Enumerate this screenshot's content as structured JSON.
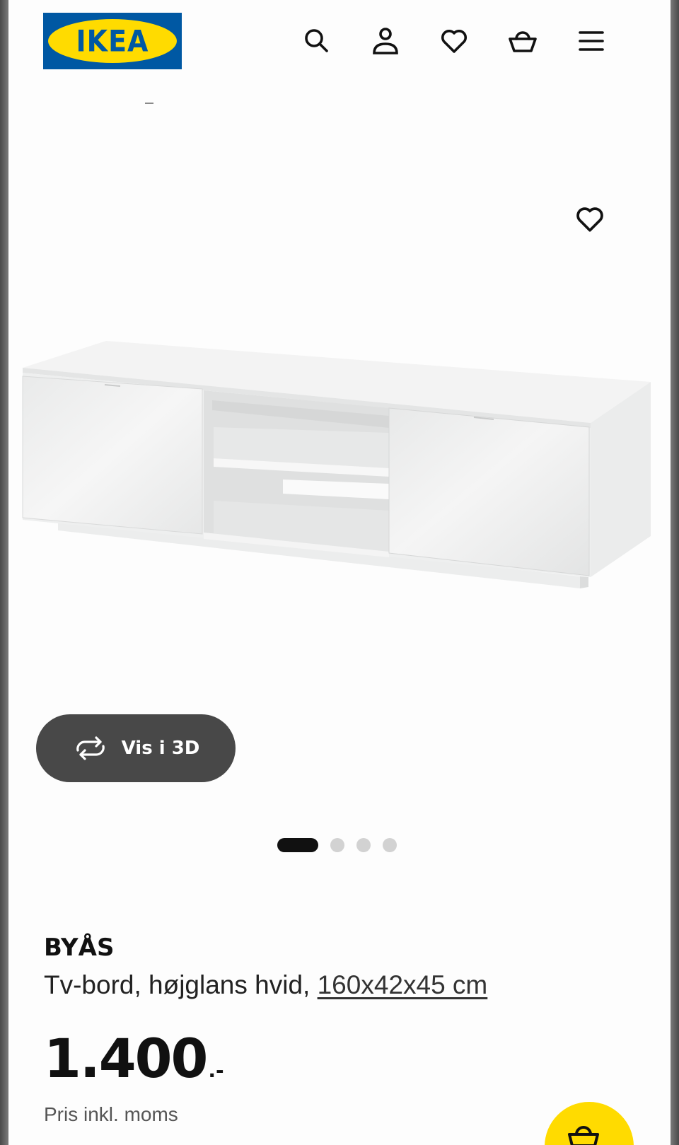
{
  "header": {
    "logo_text": "IKEA",
    "icons": [
      "search-icon",
      "user-icon",
      "heart-icon",
      "basket-icon",
      "menu-icon"
    ]
  },
  "gallery": {
    "view_3d_label": "Vis i 3D",
    "slides_total": 4,
    "active_slide": 1
  },
  "product": {
    "name": "BYÅS",
    "description": "Tv-bord, højglans hvid,",
    "dimensions": "160x42x45 cm",
    "price_integer": "1.400",
    "price_suffix": ".-",
    "price_note": "Pris inkl. moms"
  },
  "colors": {
    "brand_blue": "#0058a3",
    "brand_yellow": "#ffdb00",
    "button_dark": "#484848"
  }
}
